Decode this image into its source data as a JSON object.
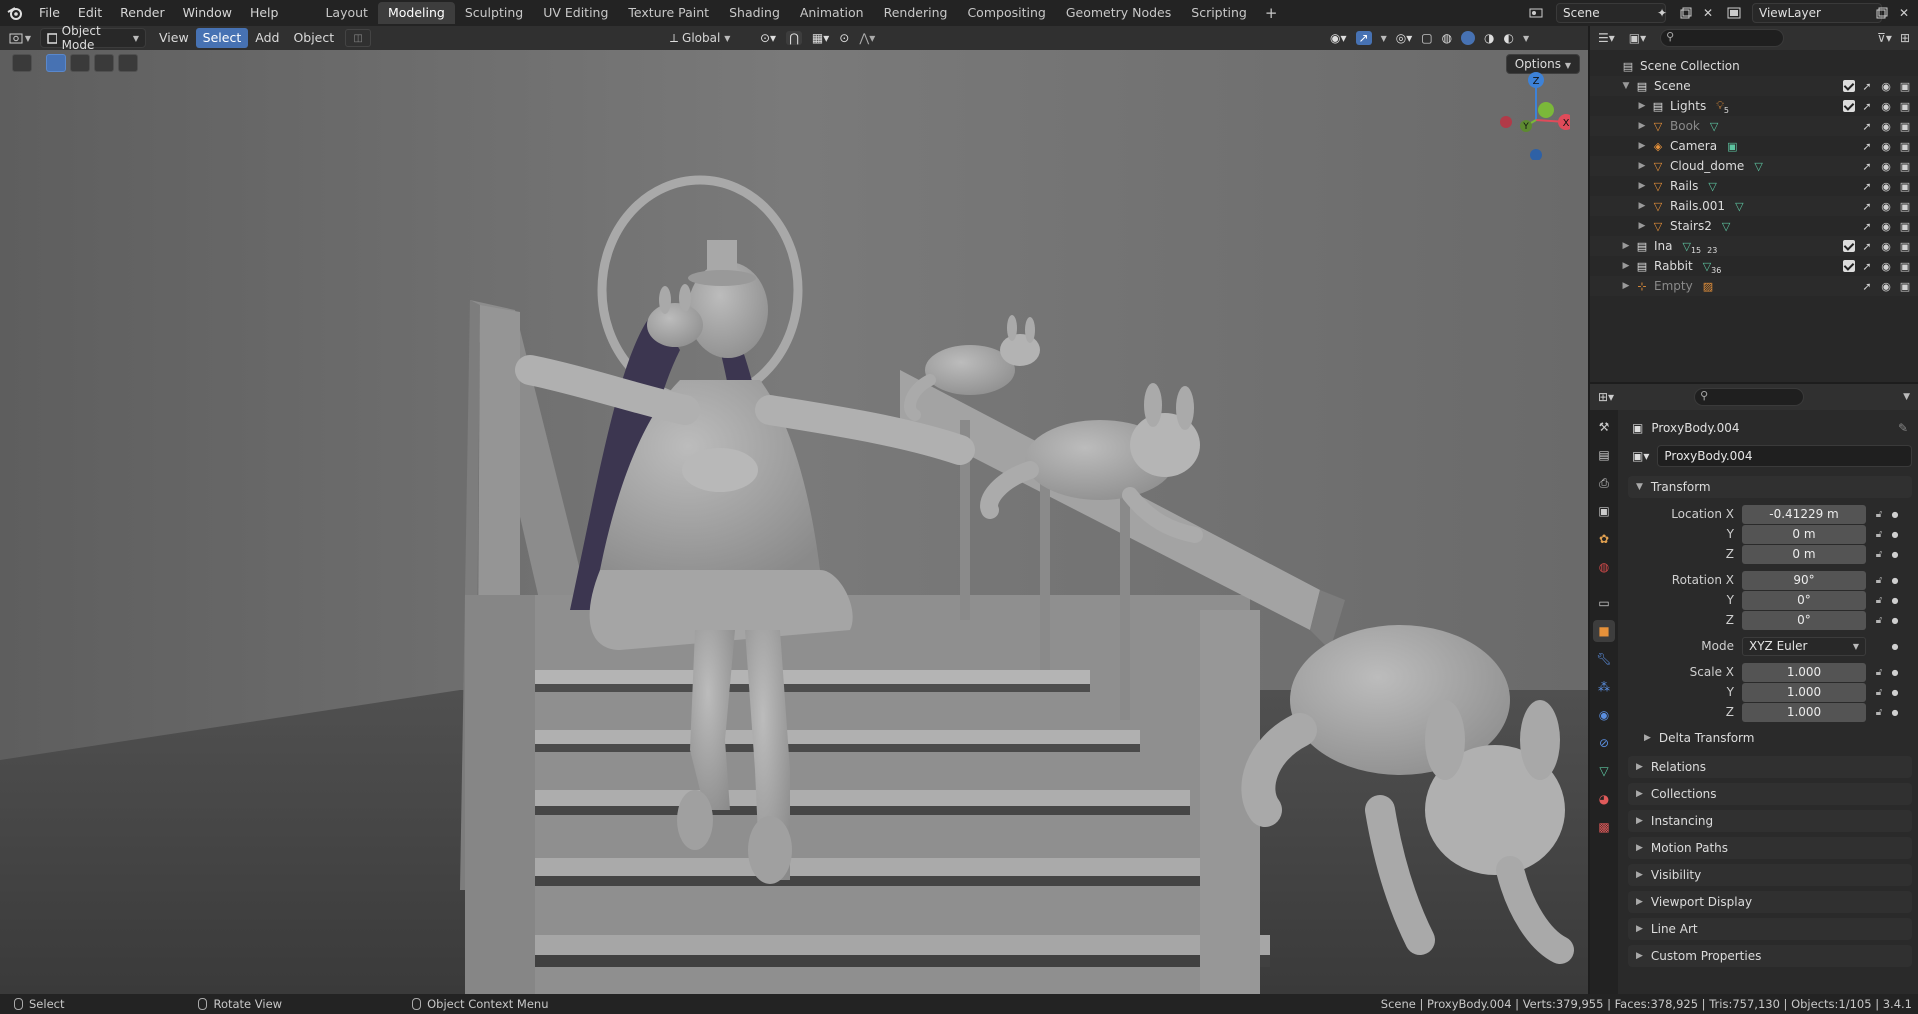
{
  "topbar": {
    "menus": [
      "File",
      "Edit",
      "Render",
      "Window",
      "Help"
    ],
    "workspaces": [
      "Layout",
      "Modeling",
      "Sculpting",
      "UV Editing",
      "Texture Paint",
      "Shading",
      "Animation",
      "Rendering",
      "Compositing",
      "Geometry Nodes",
      "Scripting"
    ],
    "active_workspace": "Modeling",
    "add_tab": "+",
    "scene_name": "Scene",
    "view_layer": "ViewLayer"
  },
  "viewport_header": {
    "mode": "Object Mode",
    "menus": [
      "View",
      "Select",
      "Add",
      "Object"
    ],
    "active_menu": "Select",
    "transform_orientation": "Global",
    "options_label": "Options"
  },
  "gizmo": {
    "z": "Z",
    "y": "Y",
    "x": "X"
  },
  "outliner": {
    "root": "Scene Collection",
    "rows": [
      {
        "label": "Scene",
        "icon": "collection-icon",
        "indent": 1,
        "expanded": true,
        "checkbox": true,
        "dim": false
      },
      {
        "label": "Lights",
        "icon": "collection-icon",
        "indent": 2,
        "badge": "5",
        "badge_icon": "light-icon",
        "checkbox": true,
        "dim": false
      },
      {
        "label": "Book",
        "icon": "mesh-object-icon",
        "indent": 2,
        "badge_icon": "mesh-data-icon",
        "checkbox": false,
        "dim": true
      },
      {
        "label": "Camera",
        "icon": "camera-object-icon",
        "indent": 2,
        "badge_icon": "camera-data-icon",
        "checkbox": false,
        "dim": false
      },
      {
        "label": "Cloud_dome",
        "icon": "mesh-object-icon",
        "indent": 2,
        "badge_icon": "mesh-data-icon",
        "checkbox": false,
        "dim": false
      },
      {
        "label": "Rails",
        "icon": "mesh-object-icon",
        "indent": 2,
        "badge_icon": "mesh-data-icon",
        "checkbox": false,
        "dim": false
      },
      {
        "label": "Rails.001",
        "icon": "mesh-object-icon",
        "indent": 2,
        "badge_icon": "mesh-data-icon",
        "checkbox": false,
        "dim": false
      },
      {
        "label": "Stairs2",
        "icon": "mesh-object-icon",
        "indent": 2,
        "badge_icon": "mesh-data-icon",
        "checkbox": false,
        "dim": false
      },
      {
        "label": "Ina",
        "icon": "collection-icon",
        "indent": 1,
        "badge": "15",
        "badge2": "23",
        "badge_icon": "mesh-data-icon",
        "checkbox": true,
        "dim": false
      },
      {
        "label": "Rabbit",
        "icon": "collection-icon",
        "indent": 1,
        "badge": "36",
        "badge_icon": "mesh-data-icon",
        "checkbox": true,
        "dim": false
      },
      {
        "label": "Empty",
        "icon": "empty-object-icon",
        "indent": 1,
        "badge_icon": "image-icon",
        "checkbox": false,
        "dim": true
      }
    ]
  },
  "properties": {
    "object_name": "ProxyBody.004",
    "object_field": "ProxyBody.004",
    "transform_title": "Transform",
    "location_label": "Location X",
    "location": [
      "-0.41229 m",
      "0 m",
      "0 m"
    ],
    "rotation_label": "Rotation X",
    "rotation": [
      "90°",
      "0°",
      "0°"
    ],
    "axis_y": "Y",
    "axis_z": "Z",
    "mode_label": "Mode",
    "mode_value": "XYZ Euler",
    "scale_label": "Scale X",
    "scale": [
      "1.000",
      "1.000",
      "1.000"
    ],
    "delta_transform": "Delta Transform",
    "panels": [
      "Relations",
      "Collections",
      "Instancing",
      "Motion Paths",
      "Visibility",
      "Viewport Display",
      "Line Art",
      "Custom Properties"
    ]
  },
  "statusbar": {
    "select": "Select",
    "rotate": "Rotate View",
    "context": "Object Context Menu",
    "stats": "Scene | ProxyBody.004 | Verts:379,955 | Faces:378,925 | Tris:757,130 | Objects:1/105 | 3.4.1"
  },
  "colors": {
    "accent": "#4772b3",
    "object_orange": "#e6913a",
    "mesh_green": "#5dc4a0",
    "axis_x": "#e04b5a",
    "axis_y": "#7bb83a",
    "axis_z": "#3d82d8"
  }
}
